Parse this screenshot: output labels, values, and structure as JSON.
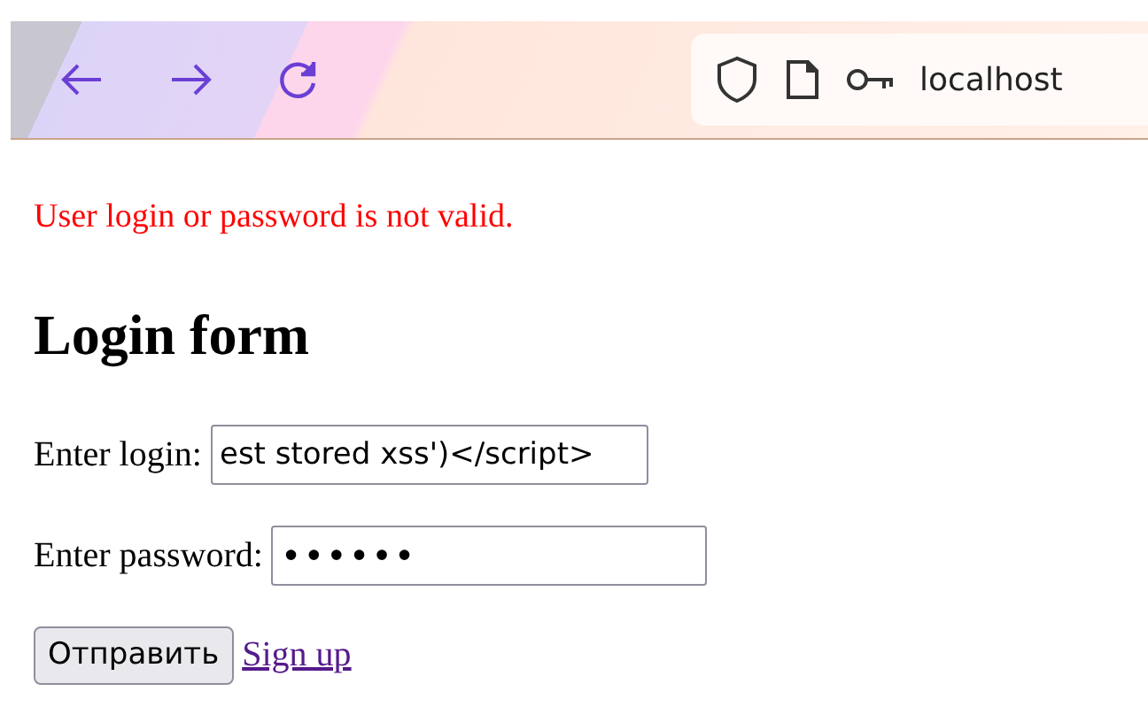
{
  "address_bar": {
    "url": "localhost"
  },
  "error": "User login or password is not valid.",
  "heading": "Login form",
  "fields": [
    {
      "label": "Enter login:",
      "value": "est stored xss')</script>",
      "kind": "text"
    },
    {
      "label": "Enter password:",
      "value": "••••••",
      "kind": "password"
    }
  ],
  "submit": "Отправить",
  "link": "Sign up"
}
